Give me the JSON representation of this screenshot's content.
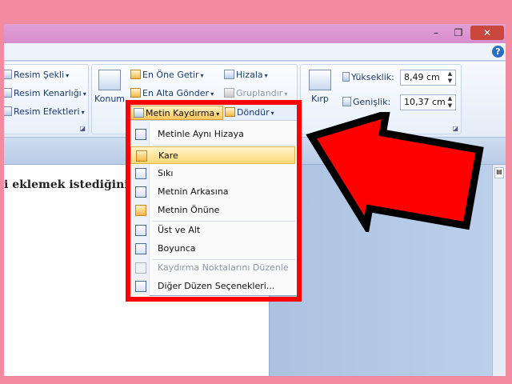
{
  "window": {
    "minimize": "–",
    "restore": "❐",
    "close": "✕",
    "help": "?"
  },
  "ribbon": {
    "styles_group": {
      "picture_shape": "Resim Şekli",
      "picture_border": "Resim Kenarlığı",
      "picture_effects": "Resim Efektleri"
    },
    "arrange_group": {
      "position": "Konum",
      "bring_to_front": "En Öne Getir",
      "send_to_back": "En Alta Gönder",
      "align": "Hizala",
      "group": "Gruplandır",
      "text_wrapping": "Metin Kaydırma",
      "rotate": "Döndür"
    },
    "size_group": {
      "crop": "Kırp",
      "height_label": "Yükseklik:",
      "height_value": "8,49 cm",
      "width_label": "Genişlik:",
      "width_value": "10,37 cm"
    }
  },
  "dropdown": {
    "items": [
      {
        "label": "Metinle Aynı Hizaya"
      },
      {
        "label": "Kare"
      },
      {
        "label": "Sıkı"
      },
      {
        "label": "Metnin Arkasına"
      },
      {
        "label": "Metnin Önüne"
      },
      {
        "label": "Üst ve Alt"
      },
      {
        "label": "Boyunca"
      },
      {
        "label": "Kaydırma Noktalarını Düzenle"
      },
      {
        "label": "Diğer Düzen Seçenekleri..."
      }
    ],
    "highlighted": "Kare"
  },
  "document": {
    "text": "i eklemek istediğiniz yere"
  },
  "colors": {
    "background": "#f28aa0",
    "annotation": "#ff0000"
  }
}
